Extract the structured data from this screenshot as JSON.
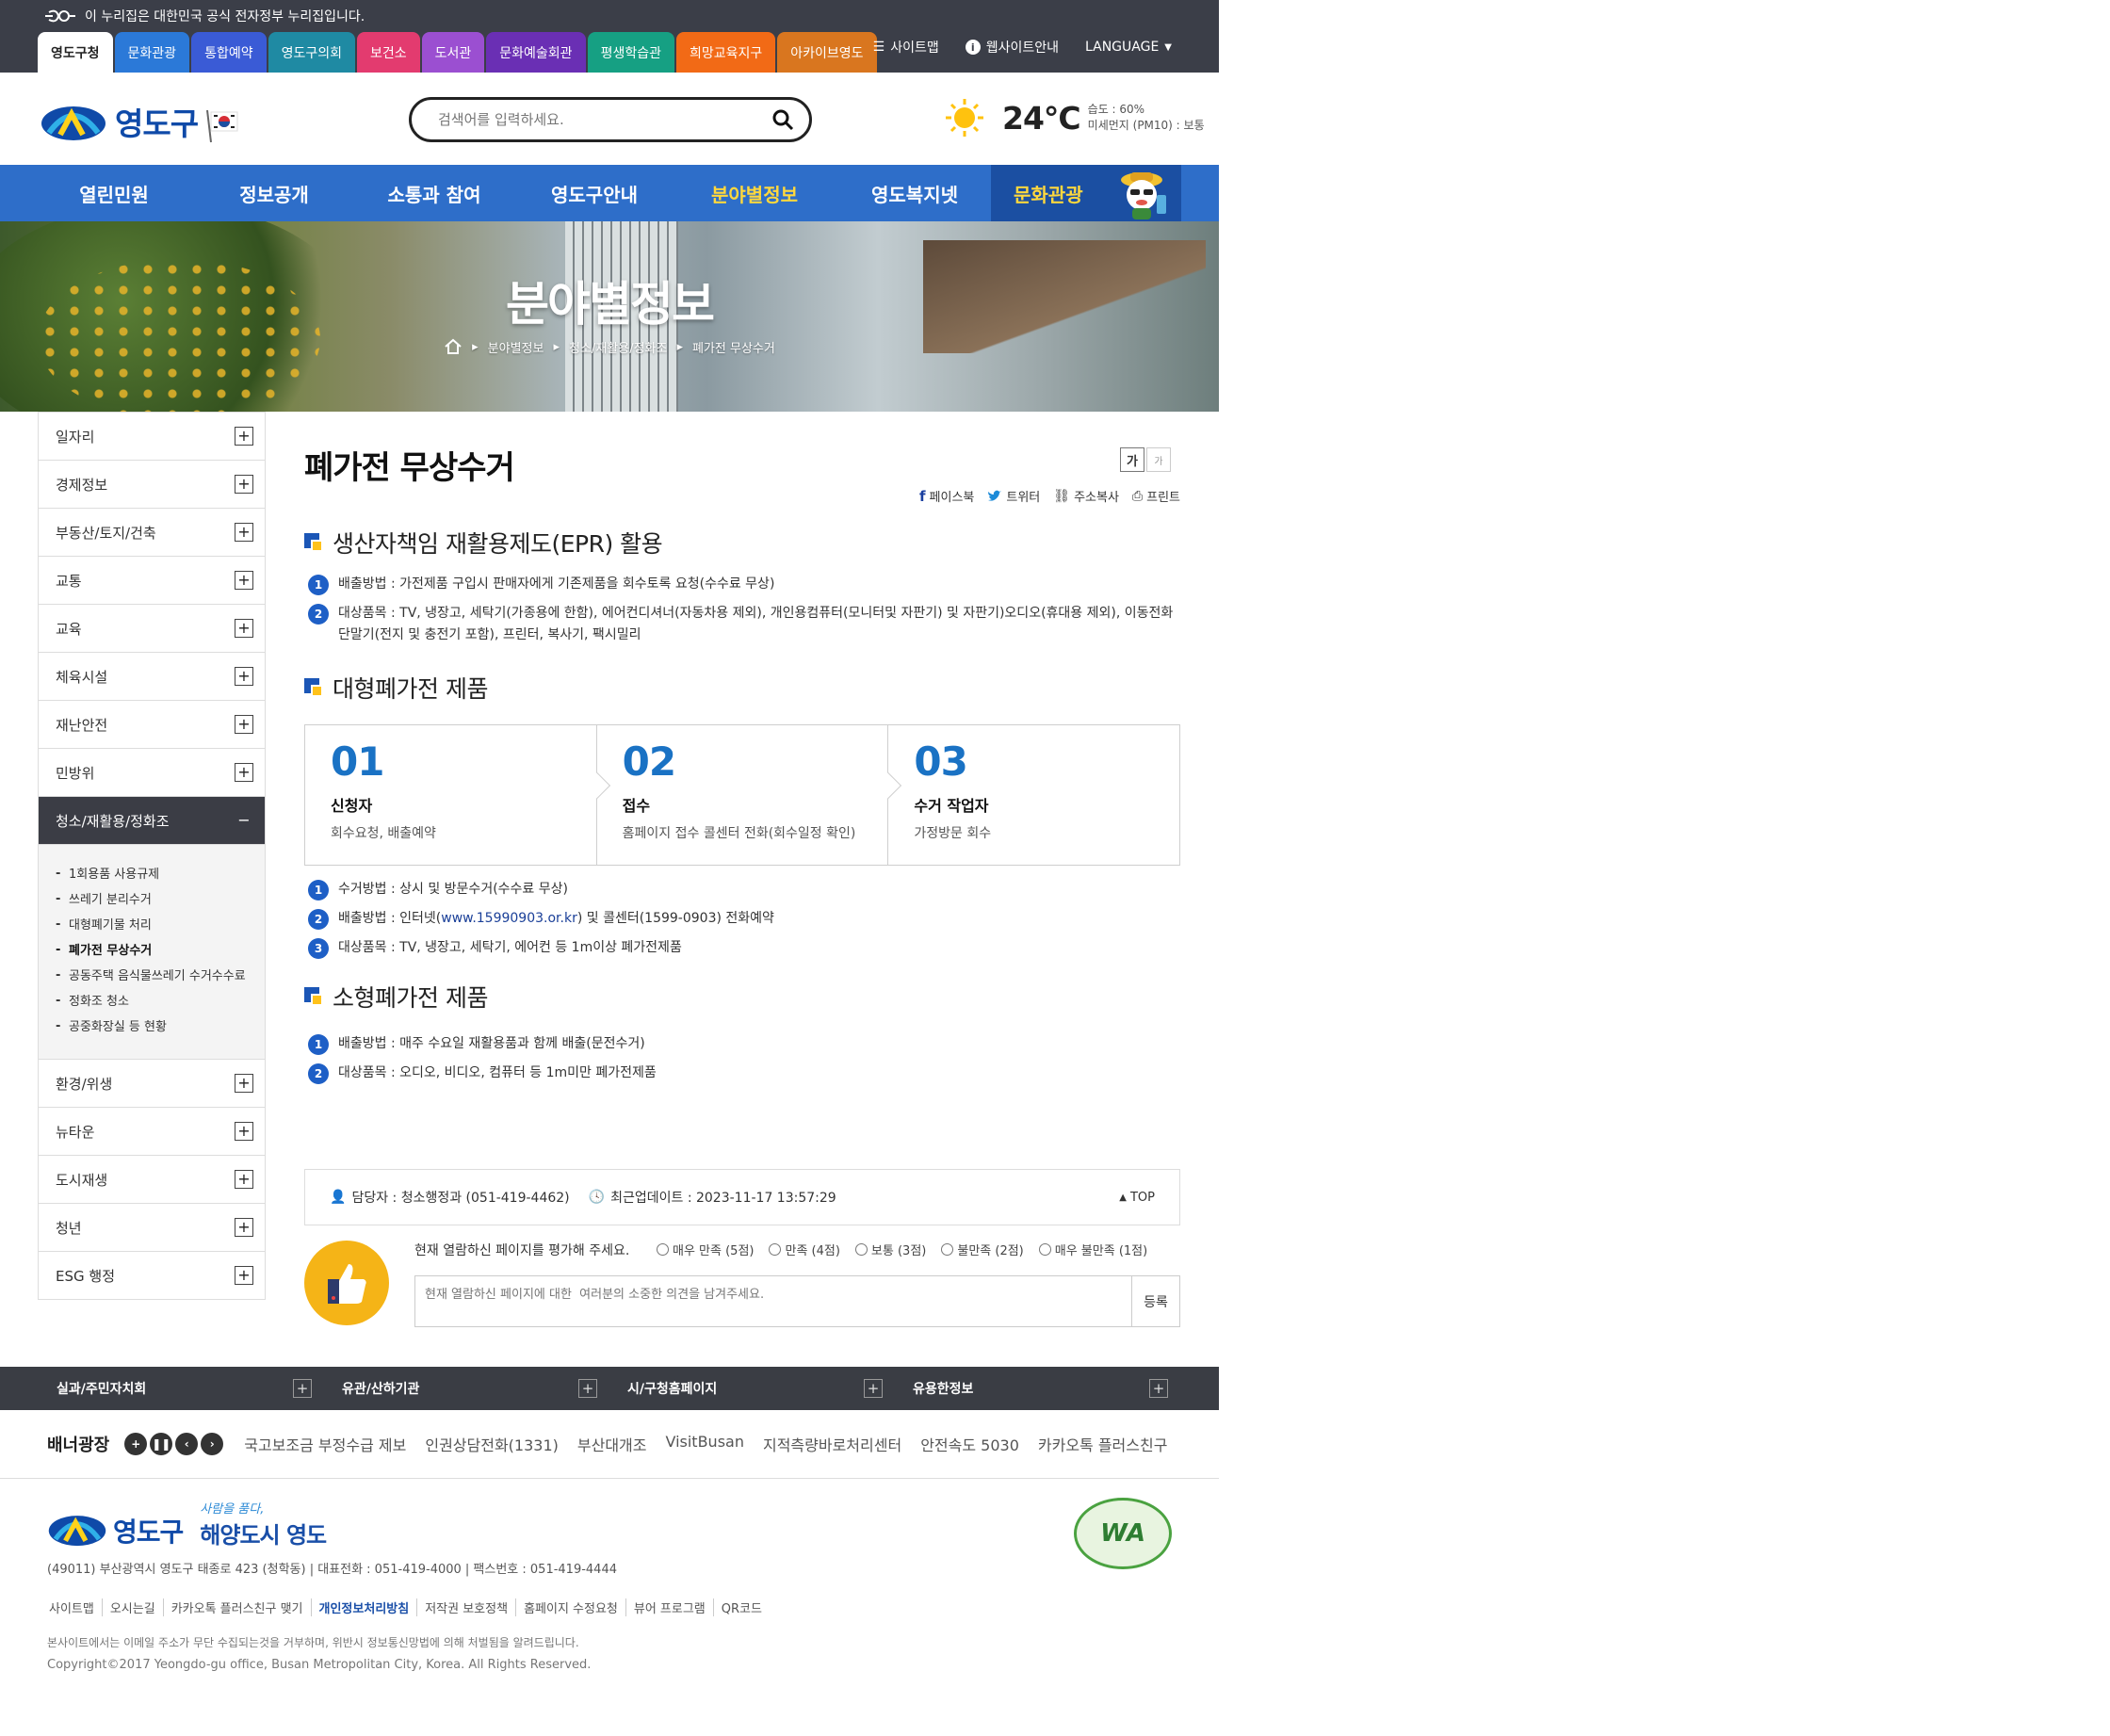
{
  "gov_notice": "이 누리집은 대한민국 공식 전자정부 누리집입니다.",
  "site_tabs": [
    {
      "label": "영도구청",
      "color": "#ffffff",
      "text": "#222222"
    },
    {
      "label": "문화관광",
      "color": "#2b79d8",
      "text": "#ffffff"
    },
    {
      "label": "통합예약",
      "color": "#3a5bd6",
      "text": "#ffffff"
    },
    {
      "label": "영도구의회",
      "color": "#1f8aa3",
      "text": "#ffffff"
    },
    {
      "label": "보건소",
      "color": "#e33b6f",
      "text": "#ffffff"
    },
    {
      "label": "도서관",
      "color": "#9b4fd1",
      "text": "#ffffff"
    },
    {
      "label": "문화예술회관",
      "color": "#6a2fb4",
      "text": "#ffffff"
    },
    {
      "label": "평생학습관",
      "color": "#16a083",
      "text": "#ffffff"
    },
    {
      "label": "희망교육지구",
      "color": "#f26a16",
      "text": "#ffffff"
    },
    {
      "label": "아카이브영도",
      "color": "#d9761f",
      "text": "#ffffff"
    }
  ],
  "util": {
    "sitemap": "사이트맵",
    "guide": "웹사이트안내",
    "language": "LANGUAGE"
  },
  "logo_text": "영도구",
  "search": {
    "placeholder": "검색어를 입력하세요."
  },
  "weather": {
    "temp": "24°C",
    "humidity": "습도 : 60%",
    "dust": "미세먼지 (PM10) : 보통"
  },
  "gnb": [
    "열린민원",
    "정보공개",
    "소통과 참여",
    "영도구안내",
    "분야별정보",
    "영도복지넷"
  ],
  "gnb_active": "분야별정보",
  "gnb_culture": "문화관광",
  "banner": {
    "title": "분야별정보",
    "crumbs": [
      "분야별정보",
      "청소/재활용/정화조",
      "폐가전 무상수거"
    ]
  },
  "lnb": {
    "items_top": [
      "일자리",
      "경제정보",
      "부동산/토지/건축",
      "교통",
      "교육",
      "체육시설",
      "재난안전",
      "민방위"
    ],
    "active": "청소/재활용/정화조",
    "sub": [
      "1회용품 사용규제",
      "쓰레기 분리수거",
      "대형폐기물 처리",
      "폐가전 무상수거",
      "공동주택 음식물쓰레기 수거수수료",
      "정화조 청소",
      "공중화장실 등 현황"
    ],
    "sub_current": "폐가전 무상수거",
    "items_bottom": [
      "환경/위생",
      "뉴타운",
      "도시재생",
      "청년",
      "ESG 행정"
    ]
  },
  "content": {
    "title": "폐가전 무상수거",
    "font_ctl": [
      "가",
      "가"
    ],
    "share": [
      "페이스북",
      "트위터",
      "주소복사",
      "프린트"
    ],
    "sec1": {
      "title": "생산자책임 재활용제도(EPR) 활용",
      "items": [
        "배출방법 : 가전제품 구입시 판매자에게 기존제품을 회수토록 요청(수수료 무상)",
        "대상품목 : TV, 냉장고, 세탁기(가종용에 한함), 에어컨디셔너(자동차용 제외), 개인용컴퓨터(모니터및 자판기) 및 자판기)오디오(휴대용 제외), 이동전화 단말기(전지 및 충전기 포함), 프린터, 복사기, 팩시밀리"
      ]
    },
    "sec2": {
      "title": "대형폐가전 제품",
      "steps": [
        {
          "no": "01",
          "name": "신청자",
          "desc": "회수요청, 배출예약"
        },
        {
          "no": "02",
          "name": "접수",
          "desc": "홈페이지 접수 콜센터 전화(회수일정 확인)"
        },
        {
          "no": "03",
          "name": "수거 작업자",
          "desc": "가정방문 회수"
        }
      ],
      "item1": "수거방법 : 상시 및 방문수거(수수료 무상)",
      "item2_pre": "배출방법 : 인터넷(",
      "item2_link": "www.15990903.or.kr",
      "item2_post": ") 및 콜센터(1599-0903) 전화예약",
      "item3": "대상품목 : TV, 냉장고, 세탁기, 에어컨 등 1m이상 폐가전제품"
    },
    "sec3": {
      "title": "소형폐가전 제품",
      "items": [
        "배출방법 : 매주 수요일 재활용품과 함께 배출(문전수거)",
        "대상품목 : 오디오, 비디오, 컴퓨터 등 1m미만 폐가전제품"
      ]
    },
    "manager": "담당자 : 청소행정과 (051-419-4462)",
    "updated": "최근업데이트 : 2023-11-17 13:57:29",
    "top": "TOP",
    "survey": {
      "question": "현재 열람하신 페이지를 평가해 주세요.",
      "options": [
        "매우 만족 (5점)",
        "만족 (4점)",
        "보통 (3점)",
        "불만족 (2점)",
        "매우 불만족 (1점)"
      ],
      "placeholder": "현재 열람하신 페이지에 대한  여러분의 소중한 의견을 남겨주세요.",
      "submit": "등록"
    }
  },
  "footer_links": [
    "실과/주민자치회",
    "유관/산하기관",
    "시/구청홈페이지",
    "유용한정보"
  ],
  "banner_zone": {
    "title": "배너광장",
    "items": [
      "국고보조금 부정수급 제보",
      "인권상담전화(1331)",
      "부산대개조",
      "VisitBusan",
      "지적측량바로처리센터",
      "안전속도 5030",
      "카카오톡 플러스친구"
    ]
  },
  "footer": {
    "logo": "영도구",
    "slogan1": "사람을 품다,",
    "slogan2": "해양도시 영도",
    "address": "(49011) 부산광역시 영도구 태종로 423 (청학동)  | 대표전화 : 051-419-4000 | 팩스번호 : 051-419-4444",
    "menu": [
      "사이트맵",
      "오시는길",
      "카카오톡 플러스친구 맺기",
      "개인정보처리방침",
      "저작권 보호정책",
      "홈페이지 수정요청",
      "뷰어 프로그램",
      "QR코드"
    ],
    "menu_highlight": "개인정보처리방침",
    "notice": "본사이트에서는 이메일 주소가 무단 수집되는것을 거부하며, 위반시 정보통신망법에 의해 처벌됨을 알려드립니다.",
    "copyright": "Copyright©2017 Yeongdo-gu office, Busan Metropolitan City, Korea. All Rights Reserved.",
    "wa": "WA"
  }
}
